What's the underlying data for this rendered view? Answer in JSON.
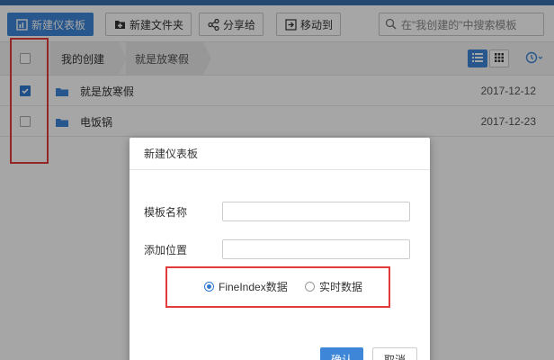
{
  "toolbar": {
    "new_dashboard": "新建仪表板",
    "new_folder": "新建文件夹",
    "share": "分享给",
    "move_to": "移动到",
    "search_placeholder": "在\"我创建的\"中搜索模板"
  },
  "breadcrumb": {
    "items": [
      "我的创建",
      "就是放寒假"
    ]
  },
  "files": [
    {
      "name": "就是放寒假",
      "date": "2017-12-12",
      "checked": true
    },
    {
      "name": "电饭锅",
      "date": "2017-12-23",
      "checked": false
    }
  ],
  "dialog": {
    "title": "新建仪表板",
    "template_name_label": "模板名称",
    "add_location_label": "添加位置",
    "radio_fineindex": "FineIndex数据",
    "radio_realtime": "实时数据",
    "selected_radio": "FineIndex数据",
    "ok_label": "确认",
    "cancel_label": "取消"
  },
  "colors": {
    "accent": "#3d86d8",
    "highlight_box": "#e23b3b"
  },
  "icons": [
    "dashboard-icon",
    "folder-plus-icon",
    "share-icon",
    "move-icon",
    "search-icon",
    "list-view-icon",
    "grid-view-icon",
    "clock-icon",
    "folder-icon"
  ]
}
